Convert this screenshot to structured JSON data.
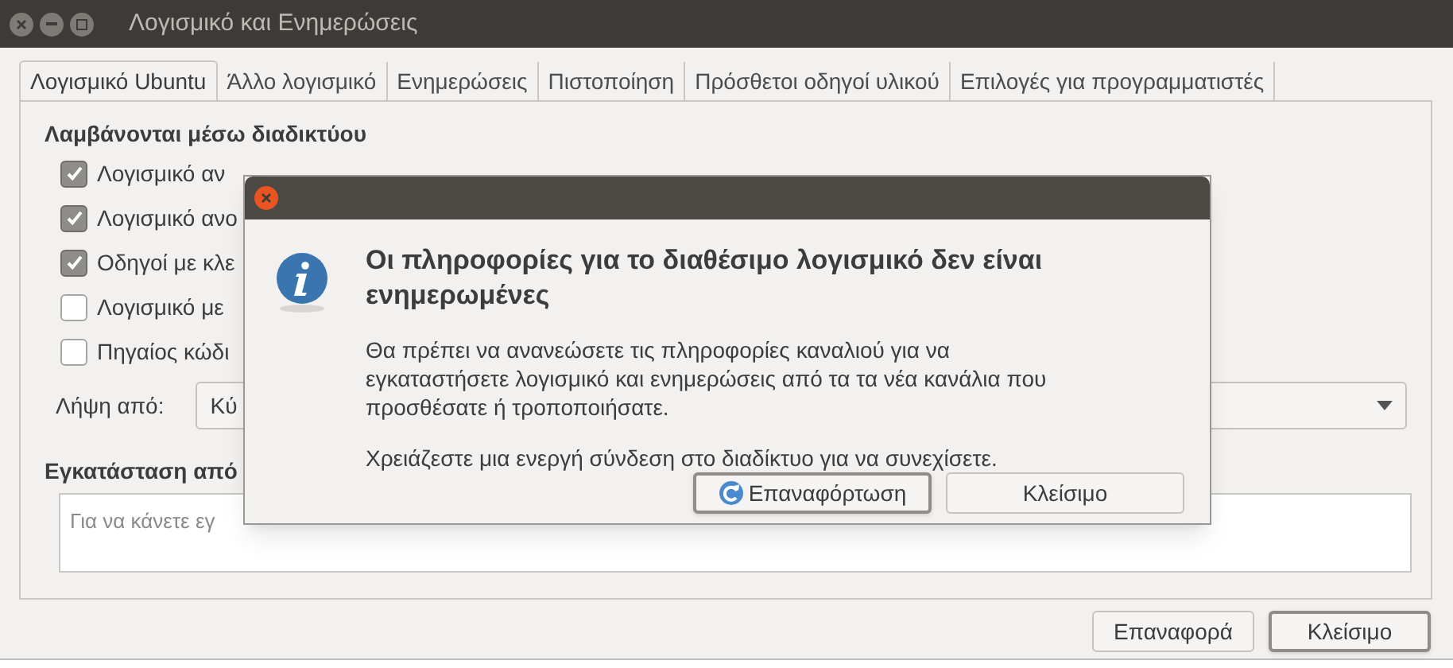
{
  "window": {
    "title": "Λογισμικό και Ενημερώσεις"
  },
  "tabs": [
    {
      "label": "Λογισμικό Ubuntu",
      "selected": true
    },
    {
      "label": "Άλλο λογισμικό",
      "selected": false
    },
    {
      "label": "Ενημερώσεις",
      "selected": false
    },
    {
      "label": "Πιστοποίηση",
      "selected": false
    },
    {
      "label": "Πρόσθετοι οδηγοί υλικού",
      "selected": false
    },
    {
      "label": "Επιλογές για προγραμματιστές",
      "selected": false
    }
  ],
  "downloadable": {
    "heading": "Λαμβάνονται μέσω διαδικτύου",
    "sources": [
      {
        "label": "Λογισμικό αν",
        "checked": true
      },
      {
        "label": "Λογισμικό ανο",
        "checked": true
      },
      {
        "label": "Οδηγοί με κλε",
        "checked": true
      },
      {
        "label": "Λογισμικό με",
        "checked": false
      },
      {
        "label": "Πηγαίος κώδι",
        "checked": false
      }
    ],
    "download_from": {
      "label": "Λήψη από:",
      "value": "Κύ"
    }
  },
  "install_from": {
    "heading": "Εγκατάσταση από",
    "hint": "Για να κάνετε εγ"
  },
  "buttons": [
    {
      "label": "Επαναφορά",
      "default": false
    },
    {
      "label": "Κλείσιμο",
      "default": true
    }
  ],
  "dialog": {
    "title": "Οι πληροφορίες για το διαθέσιμο λογισμικό δεν είναι ενημερωμένες",
    "paragraphs": [
      "Θα πρέπει να ανανεώσετε τις πληροφορίες καναλιού για να εγκαταστήσετε λογισμικό και ενημερώσεις από τα τα νέα κανάλια που προσθέσατε ή τροποποιήσατε.",
      "Χρειάζεστε μια ενεργή σύνδεση στο διαδίκτυο για να συνεχίσετε."
    ],
    "buttons": [
      {
        "label": "Επαναφόρτωση",
        "kind": "reload",
        "default": true
      },
      {
        "label": "Κλείσιμο",
        "kind": "plain",
        "default": false
      }
    ]
  }
}
